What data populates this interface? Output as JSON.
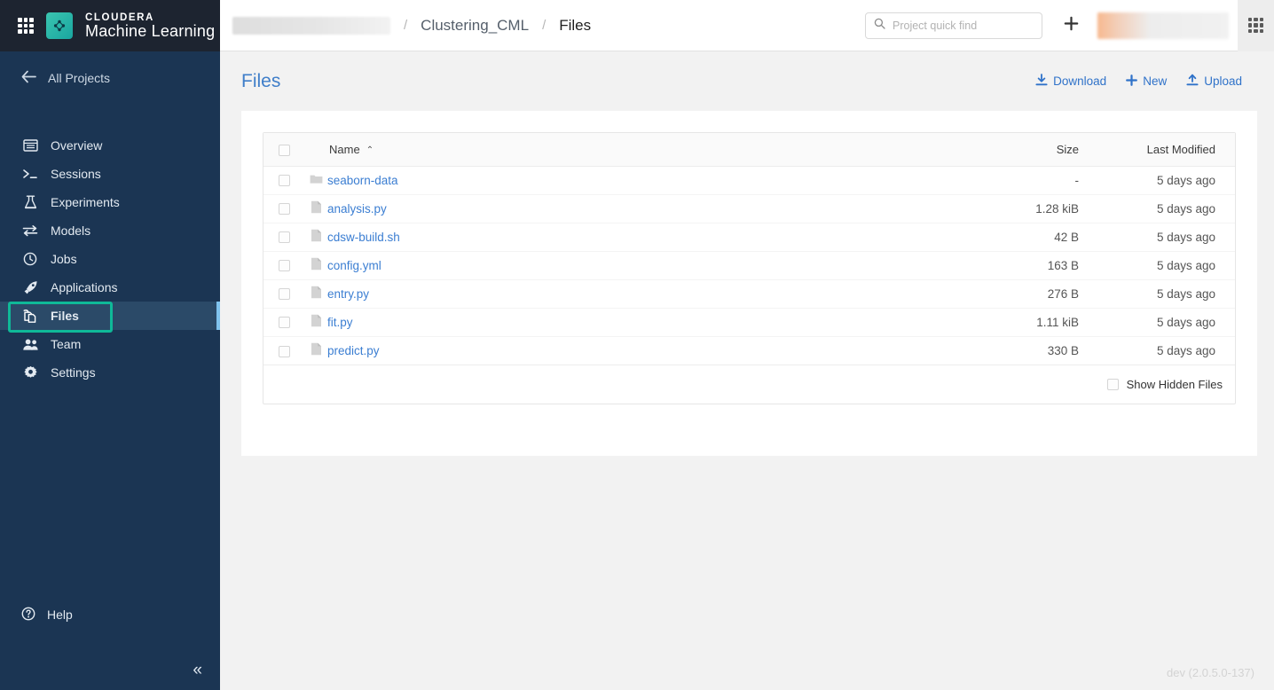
{
  "brand": {
    "line1": "CLOUDERA",
    "line2": "Machine Learning",
    "waffle_icon": "apps-grid-icon",
    "logo_icon": "cloudera-mark-icon"
  },
  "sidebar": {
    "all_projects": {
      "label": "All Projects",
      "icon": "arrow-left-icon"
    },
    "items": [
      {
        "label": "Overview",
        "icon": "overview-icon",
        "selected": false
      },
      {
        "label": "Sessions",
        "icon": "terminal-icon",
        "selected": false
      },
      {
        "label": "Experiments",
        "icon": "flask-icon",
        "selected": false
      },
      {
        "label": "Models",
        "icon": "arrows-swap-icon",
        "selected": false
      },
      {
        "label": "Jobs",
        "icon": "clock-icon",
        "selected": false
      },
      {
        "label": "Applications",
        "icon": "rocket-icon",
        "selected": false
      },
      {
        "label": "Files",
        "icon": "files-icon",
        "selected": true
      },
      {
        "label": "Team",
        "icon": "people-icon",
        "selected": false
      },
      {
        "label": "Settings",
        "icon": "gear-icon",
        "selected": false
      }
    ],
    "help": {
      "label": "Help",
      "icon": "question-circle-icon"
    },
    "collapse": {
      "icon": "chevron-double-left-icon",
      "glyph": "«"
    }
  },
  "topbar": {
    "breadcrumb": [
      {
        "label": "",
        "redacted": true
      },
      {
        "label": "Clustering_CML",
        "redacted": false
      },
      {
        "label": "Files",
        "redacted": false
      }
    ],
    "separator": "/",
    "search": {
      "placeholder": "Project quick find",
      "value": "",
      "icon": "search-icon"
    },
    "add_button": {
      "icon": "plus-icon",
      "label": ""
    },
    "user_menu": {
      "label": "",
      "redacted": true,
      "avatar_color": "#f4a87a"
    },
    "apps_grid": {
      "icon": "apps-grid-icon"
    }
  },
  "page": {
    "title": "Files",
    "actions": [
      {
        "label": "Download",
        "icon": "download-icon"
      },
      {
        "label": "New",
        "icon": "plus-icon"
      },
      {
        "label": "Upload",
        "icon": "upload-icon"
      }
    ]
  },
  "table": {
    "columns": {
      "select": "",
      "name": "Name",
      "size": "Size",
      "modified": "Last Modified"
    },
    "sort": {
      "column": "Name",
      "direction": "asc",
      "caret": "⌃"
    },
    "rows": [
      {
        "name": "seaborn-data",
        "type": "folder",
        "icon": "folder-icon",
        "size": "-",
        "modified": "5 days ago",
        "checked": false
      },
      {
        "name": "analysis.py",
        "type": "file",
        "icon": "file-icon",
        "size": "1.28 kiB",
        "modified": "5 days ago",
        "checked": false
      },
      {
        "name": "cdsw-build.sh",
        "type": "file",
        "icon": "file-icon",
        "size": "42 B",
        "modified": "5 days ago",
        "checked": false
      },
      {
        "name": "config.yml",
        "type": "file",
        "icon": "file-icon",
        "size": "163 B",
        "modified": "5 days ago",
        "checked": false
      },
      {
        "name": "entry.py",
        "type": "file",
        "icon": "file-icon",
        "size": "276 B",
        "modified": "5 days ago",
        "checked": false
      },
      {
        "name": "fit.py",
        "type": "file",
        "icon": "file-icon",
        "size": "1.11 kiB",
        "modified": "5 days ago",
        "checked": false
      },
      {
        "name": "predict.py",
        "type": "file",
        "icon": "file-icon",
        "size": "330 B",
        "modified": "5 days ago",
        "checked": false
      }
    ],
    "show_hidden": {
      "label": "Show Hidden Files",
      "checked": false
    }
  },
  "footer": {
    "version": "dev (2.0.5.0-137)"
  },
  "colors": {
    "sidebar_bg": "#1b3553",
    "sidebar_top_bg": "#1d2430",
    "selected_row_bg": "#2b4a68",
    "selected_accent": "#7fc3ee",
    "highlight_box": "#0fb998",
    "link_blue": "#3b7ed2",
    "title_blue": "#3f7ec9",
    "page_bg": "#f2f2f2"
  }
}
